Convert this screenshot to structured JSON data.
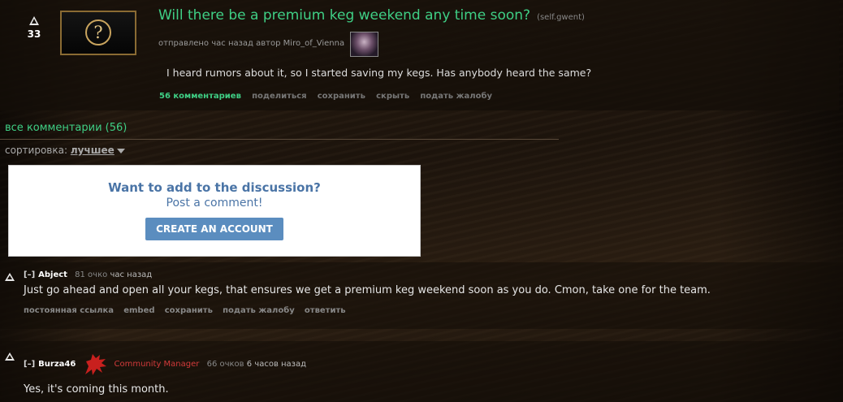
{
  "post": {
    "score": "33",
    "thumbnail_glyph": "?",
    "title": "Will there be a premium keg weekend any time soon?",
    "domain": "(self.gwent)",
    "tagline_prefix": "отправлено час назад автор",
    "author": "Miro_of_Vienna",
    "selftext": "I heard rumors about it, so I started saving my kegs. Has anybody heard the same?",
    "buttons": {
      "comments": "56 комментариев",
      "share": "поделиться",
      "save": "сохранить",
      "hide": "скрыть",
      "report": "подать жалобу"
    }
  },
  "comments_header": "все комментарии (56)",
  "sort": {
    "label": "сортировка:",
    "value": "лучшее"
  },
  "cta": {
    "title": "Want to add to the discussion?",
    "subtitle": "Post a comment!",
    "button": "CREATE AN ACCOUNT"
  },
  "comments": [
    {
      "collapse": "[–]",
      "author": "Abject",
      "score": "81 очко",
      "time": "час назад",
      "body": "Just go ahead and open all your kegs, that ensures we get a premium keg weekend soon as you do. Cmon, take one for the team.",
      "buttons": {
        "permalink": "постоянная ссылка",
        "embed": "embed",
        "save": "сохранить",
        "report": "подать жалобу",
        "reply": "ответить"
      }
    },
    {
      "collapse": "[–]",
      "author": "Burza46",
      "flair": "Community Manager",
      "score": "66 очков",
      "time": "6 часов назад",
      "body": "Yes, it's coming this month."
    }
  ],
  "colors": {
    "link_green": "#3fcf85",
    "cta_blue": "#5b8dbf",
    "flair_red": "#d23a3a"
  },
  "icons": {
    "vote": "upvote-arrow-icon",
    "flair": "cd-projekt-wolf-icon",
    "sort_caret": "chevron-down-icon"
  }
}
